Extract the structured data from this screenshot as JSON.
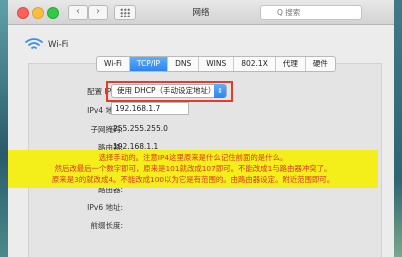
{
  "window": {
    "title": "网络",
    "search_placeholder": "Q 搜索"
  },
  "network": {
    "name": "Wi-Fi"
  },
  "tabs": [
    "Wi-Fi",
    "TCP/IP",
    "DNS",
    "WINS",
    "802.1X",
    "代理",
    "硬件"
  ],
  "active_tab": "TCP/IP",
  "form": {
    "configure_ipv4_label": "配置 IPv4:",
    "configure_ipv4_value": "使用 DHCP（手动设定地址）",
    "ipv4_address_label": "IPv4 地址:",
    "ipv4_address_value": "192.168.1.7",
    "subnet_mask_label": "子网掩码:",
    "subnet_mask_value": "255.255.255.0",
    "router_label": "路由器:",
    "router_value": "192.168.1.1",
    "router_label_2": "路由器:",
    "ipv6_address_label": "IPv6 地址:",
    "prefix_length_label": "前缀长度:"
  },
  "annotation": {
    "line1": "选择手动的。注意IP4这里原来是什么记住前面的是什么。",
    "line2": "然后改最后一个数字即可，原来是101就改成107即可。不能改成1与路由器冲突了。",
    "line3": "原来是3的就改成4。不能改成100以为它是有范围的。由路由器设定。附近范围即可。",
    "highlight_color": "#f4ee1a",
    "text_color": "#e23321",
    "box_color": "#e53b2c"
  }
}
